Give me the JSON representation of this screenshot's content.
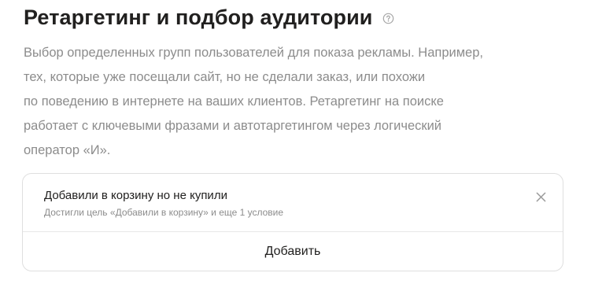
{
  "section": {
    "title": "Ретаргетинг и подбор аудитории",
    "help_icon": "question-circle-icon",
    "description_lines": [
      "Выбор определенных групп пользователей для показа рекламы. Например,",
      "тех, которые уже посещали сайт, но не сделали заказ, или похожи",
      "по поведению в интернете на ваших клиентов. Ретаргетинг на поиске",
      "работает с ключевыми фразами и автотаргетингом через логический",
      "оператор «И»."
    ]
  },
  "conditions": [
    {
      "name": "Добавили в корзину но не купили",
      "description": "Достигли цель «Добавили в корзину» и еще 1 условие",
      "remove_icon": "close-icon"
    }
  ],
  "add_button": {
    "label": "Добавить"
  },
  "colors": {
    "text_primary": "#21201f",
    "text_secondary": "#8c8c8c",
    "border": "#dfdfdf",
    "background": "#ffffff"
  }
}
